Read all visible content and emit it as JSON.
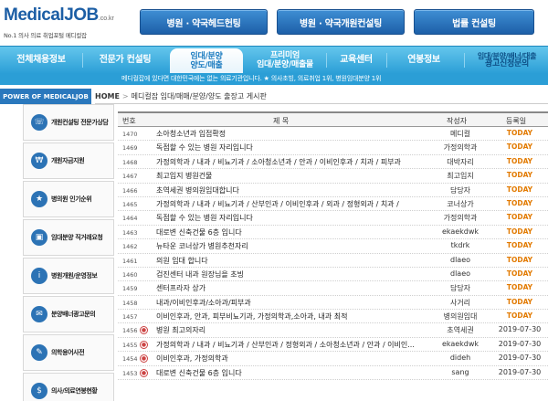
{
  "header": {
    "logo_main": "MedicalJOB",
    "logo_domain": ".co.kr",
    "logo_sub": "No.1 의사 의료 취업포털 메디컬잡",
    "top_buttons": [
      "병원 · 약국헤드헌팅",
      "병원 · 약국개원컨설팅",
      "법률 컨설팅"
    ]
  },
  "nav": {
    "items": [
      {
        "label": "전체채용정보"
      },
      {
        "label": "전문가 컨설팅"
      },
      {
        "label_1": "임대/분양",
        "label_2": "양도/매출"
      },
      {
        "label_1": "프리미엄",
        "label_2": "임대/분양/매출물"
      },
      {
        "label": "교육센터"
      },
      {
        "label": "연봉정보"
      },
      {
        "label_1": "임대/분양/배너/대출",
        "label_2": "광고신청문의"
      }
    ],
    "sub_text": "메디컬잡에 있다면 대한민국에는 없는 의료기관입니다. ★ 의사초빙, 의료취업 1위, 병원임대분양 1위"
  },
  "breadcrumb": {
    "power_label": "POWER OF MEDICALJOB",
    "home": "HOME",
    "separator": ">",
    "current": "메디컬잡 임대/매매/분양/양도 출장고 게시판"
  },
  "sidebar": {
    "items": [
      {
        "label": "개원컨설팅 전문가상담",
        "icon": "consult-icon"
      },
      {
        "label": "개원자금지원",
        "icon": "money-icon"
      },
      {
        "label": "병의원 인기순위",
        "icon": "ranking-icon"
      },
      {
        "label": "임대분양 직거래요청",
        "icon": "building-icon"
      },
      {
        "label": "병원개원/운영정보",
        "icon": "info-icon"
      },
      {
        "label": "분양배너광고문의",
        "icon": "banner-icon"
      },
      {
        "label": "의학용어사전",
        "icon": "book-icon"
      },
      {
        "label": "의사/의료연봉현황",
        "icon": "salary-icon"
      }
    ]
  },
  "board": {
    "columns": [
      "번호",
      "제 목",
      "작성자",
      "등록일"
    ],
    "rows": [
      {
        "no": "1470",
        "title": "소아청소년과 입접확정",
        "author": "메디컬",
        "date": "TODAY"
      },
      {
        "no": "1469",
        "title": "독점할 수 있는 병원 자리입니다",
        "author": "가정의학과",
        "date": "TODAY"
      },
      {
        "no": "1468",
        "title": "가정의학과 / 내과 / 비뇨기과 / 소아청소년과 / 안과 / 이비인후과 / 치과 / 피부과",
        "author": "대박자리",
        "date": "TODAY"
      },
      {
        "no": "1467",
        "title": "최고입지 병원건물",
        "author": "최고입지",
        "date": "TODAY"
      },
      {
        "no": "1466",
        "title": "초역세권 병의원임대합니다",
        "author": "담당자",
        "date": "TODAY"
      },
      {
        "no": "1465",
        "title": "가정의학과 / 내과 / 비뇨기과 / 산부인과 / 이비인후과 / 외과 / 정형외과 / 치과 /",
        "author": "코너상가",
        "date": "TODAY"
      },
      {
        "no": "1464",
        "title": "독점할 수 있는 병원 자리입니다",
        "author": "가정의학과",
        "date": "TODAY"
      },
      {
        "no": "1463",
        "title": "대로변 신축건물 6층 입니다",
        "author": "ekaekdwk",
        "date": "TODAY"
      },
      {
        "no": "1462",
        "title": "뉴타운 코너상가 병원추천자리",
        "author": "tkdrk",
        "date": "TODAY"
      },
      {
        "no": "1461",
        "title": "의원 임대 합니다",
        "author": "dlaeo",
        "date": "TODAY"
      },
      {
        "no": "1460",
        "title": "검진센터 내과 원장님을 초빙",
        "author": "dlaeo",
        "date": "TODAY"
      },
      {
        "no": "1459",
        "title": "센터프라자 상가",
        "author": "담당자",
        "date": "TODAY"
      },
      {
        "no": "1458",
        "title": "내과/이비인후과/소아과/피부과",
        "author": "사거리",
        "date": "TODAY"
      },
      {
        "no": "1457",
        "title": "이비인후과, 안과, 피부비뇨기과, 가정의학과,소아과, 내과 최적",
        "author": "병의원임대",
        "date": "TODAY"
      },
      {
        "no": "1456",
        "title": "병원 최고의자리",
        "author": "초역세권",
        "date": "2019-07-30",
        "icon": true
      },
      {
        "no": "1455",
        "title": "가정의학과 / 내과 / 비뇨기과 / 산부인과 / 정형외과 / 소아청소년과 / 안과 / 이비인...",
        "author": "ekaekdwk",
        "date": "2019-07-30",
        "icon": true
      },
      {
        "no": "1454",
        "title": "이비인후과, 가정의학과",
        "author": "dideh",
        "date": "2019-07-30",
        "icon": true
      },
      {
        "no": "1453",
        "title": "대로변 신축건물 6층 입니다",
        "author": "sang",
        "date": "2019-07-30",
        "icon": true
      }
    ]
  }
}
